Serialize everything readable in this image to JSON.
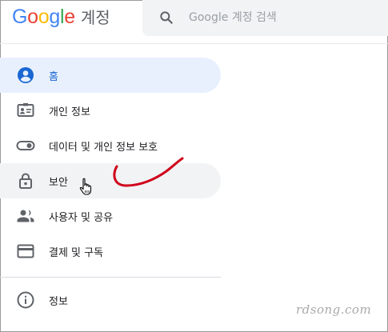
{
  "header": {
    "logo_letters": [
      "G",
      "o",
      "o",
      "g",
      "l",
      "e"
    ],
    "logo_colors": [
      "#4285f4",
      "#ea4335",
      "#fbbc05",
      "#4285f4",
      "#34a853",
      "#ea4335"
    ],
    "product": "계정",
    "search_placeholder": "Google 계정 검색",
    "search_icon": "search-icon"
  },
  "sidebar": {
    "items": [
      {
        "label": "홈",
        "icon": "account-circle-icon",
        "state": "selected"
      },
      {
        "label": "개인 정보",
        "icon": "id-card-icon"
      },
      {
        "label": "데이터 및 개인 정보 보호",
        "icon": "toggle-icon"
      },
      {
        "label": "보안",
        "icon": "lock-icon",
        "state": "hovered"
      },
      {
        "label": "사용자 및 공유",
        "icon": "people-icon"
      },
      {
        "label": "결제 및 구독",
        "icon": "credit-card-icon"
      }
    ],
    "footer_item": {
      "label": "정보",
      "icon": "info-icon"
    }
  },
  "colors": {
    "selected_bg": "#e8f0fe",
    "selected_text": "#1967d2",
    "hover_bg": "#f1f3f4",
    "icon_gray": "#5f6368",
    "annotation_red": "#d0021b"
  },
  "watermark": "rdsong.com"
}
